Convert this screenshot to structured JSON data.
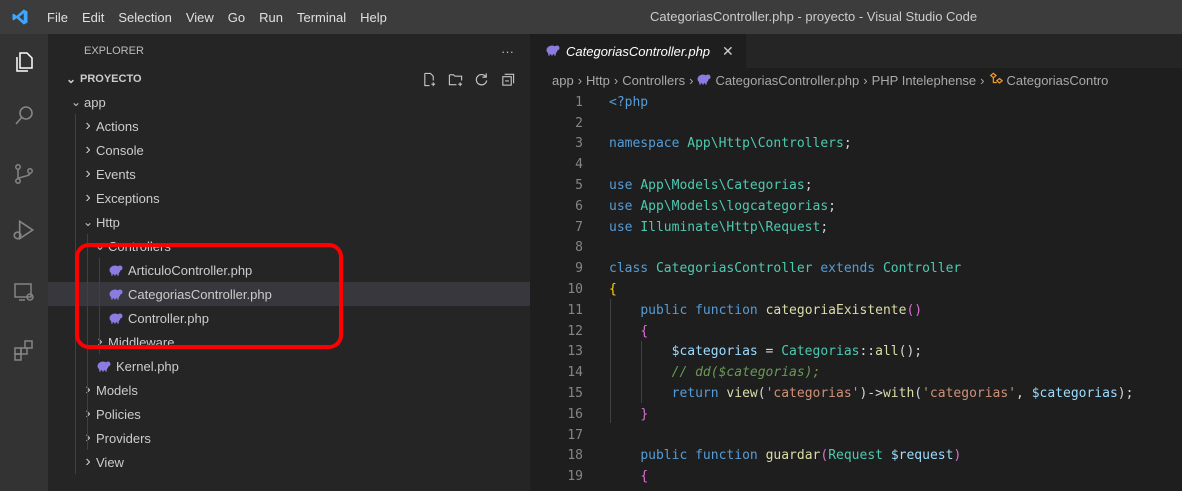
{
  "titlebar": {
    "menu": [
      "File",
      "Edit",
      "Selection",
      "View",
      "Go",
      "Run",
      "Terminal",
      "Help"
    ],
    "window_title": "CategoriasController.php - proyecto - Visual Studio Code"
  },
  "activity_icons": [
    "explorer-icon",
    "search-icon",
    "source-control-icon",
    "run-debug-icon",
    "remote-explorer-icon",
    "extensions-icon"
  ],
  "sidebar": {
    "title": "EXPLORER",
    "more": "···",
    "project": "PROYECTO",
    "project_actions": [
      "new-file-icon",
      "new-folder-icon",
      "refresh-icon",
      "collapse-all-icon"
    ],
    "tree": [
      {
        "label": "app",
        "type": "folder",
        "open": true,
        "depth": 0
      },
      {
        "label": "Actions",
        "type": "folder",
        "open": false,
        "depth": 1
      },
      {
        "label": "Console",
        "type": "folder",
        "open": false,
        "depth": 1
      },
      {
        "label": "Events",
        "type": "folder",
        "open": false,
        "depth": 1
      },
      {
        "label": "Exceptions",
        "type": "folder",
        "open": false,
        "depth": 1
      },
      {
        "label": "Http",
        "type": "folder",
        "open": true,
        "depth": 1
      },
      {
        "label": "Controllers",
        "type": "folder",
        "open": true,
        "depth": 2
      },
      {
        "label": "ArticuloController.php",
        "type": "php",
        "depth": 3
      },
      {
        "label": "CategoriasController.php",
        "type": "php",
        "depth": 3,
        "selected": true
      },
      {
        "label": "Controller.php",
        "type": "php",
        "depth": 3
      },
      {
        "label": "Middleware",
        "type": "folder",
        "open": false,
        "depth": 2
      },
      {
        "label": "Kernel.php",
        "type": "php",
        "depth": 2
      },
      {
        "label": "Models",
        "type": "folder",
        "open": false,
        "depth": 1
      },
      {
        "label": "Policies",
        "type": "folder",
        "open": false,
        "depth": 1
      },
      {
        "label": "Providers",
        "type": "folder",
        "open": false,
        "depth": 1
      },
      {
        "label": "View",
        "type": "folder",
        "open": false,
        "depth": 1
      }
    ]
  },
  "editor": {
    "tab": {
      "label": "CategoriasController.php",
      "close": "✕"
    },
    "breadcrumbs": [
      "app",
      "Http",
      "Controllers",
      "CategoriasController.php",
      "PHP Intelephense",
      "CategoriasContro"
    ],
    "lines": [
      {
        "n": "1",
        "tokens": [
          [
            "tag",
            "<?php"
          ]
        ]
      },
      {
        "n": "2",
        "tokens": []
      },
      {
        "n": "3",
        "tokens": [
          [
            "kw",
            "namespace"
          ],
          [
            "plain",
            " "
          ],
          [
            "cls",
            "App\\Http\\Controllers"
          ],
          [
            "plain",
            ";"
          ]
        ]
      },
      {
        "n": "4",
        "tokens": []
      },
      {
        "n": "5",
        "tokens": [
          [
            "kw",
            "use"
          ],
          [
            "plain",
            " "
          ],
          [
            "cls",
            "App\\Models\\Categorias"
          ],
          [
            "plain",
            ";"
          ]
        ]
      },
      {
        "n": "6",
        "tokens": [
          [
            "kw",
            "use"
          ],
          [
            "plain",
            " "
          ],
          [
            "cls",
            "App\\Models\\logcategorias"
          ],
          [
            "plain",
            ";"
          ]
        ]
      },
      {
        "n": "7",
        "tokens": [
          [
            "kw",
            "use"
          ],
          [
            "plain",
            " "
          ],
          [
            "cls",
            "Illuminate\\Http\\Request"
          ],
          [
            "plain",
            ";"
          ]
        ]
      },
      {
        "n": "8",
        "tokens": []
      },
      {
        "n": "9",
        "tokens": [
          [
            "kw",
            "class"
          ],
          [
            "plain",
            " "
          ],
          [
            "cls",
            "CategoriasController"
          ],
          [
            "plain",
            " "
          ],
          [
            "kw",
            "extends"
          ],
          [
            "plain",
            " "
          ],
          [
            "cls",
            "Controller"
          ]
        ]
      },
      {
        "n": "10",
        "tokens": [
          [
            "br",
            "{"
          ]
        ]
      },
      {
        "n": "11",
        "tokens": [
          [
            "plain",
            "    "
          ],
          [
            "kw",
            "public"
          ],
          [
            "plain",
            " "
          ],
          [
            "kw",
            "function"
          ],
          [
            "plain",
            " "
          ],
          [
            "fn",
            "categoriaExistente"
          ],
          [
            "br2",
            "()"
          ]
        ]
      },
      {
        "n": "12",
        "tokens": [
          [
            "plain",
            "    "
          ],
          [
            "br2",
            "{"
          ]
        ]
      },
      {
        "n": "13",
        "tokens": [
          [
            "plain",
            "        "
          ],
          [
            "var",
            "$categorias"
          ],
          [
            "plain",
            " = "
          ],
          [
            "cls",
            "Categorias"
          ],
          [
            "plain",
            "::"
          ],
          [
            "fn",
            "all"
          ],
          [
            "plain",
            "();"
          ]
        ]
      },
      {
        "n": "14",
        "tokens": [
          [
            "plain",
            "        "
          ],
          [
            "cmt",
            "// dd($categorias);"
          ]
        ]
      },
      {
        "n": "15",
        "tokens": [
          [
            "plain",
            "        "
          ],
          [
            "kw",
            "return"
          ],
          [
            "plain",
            " "
          ],
          [
            "fn",
            "view"
          ],
          [
            "plain",
            "("
          ],
          [
            "str",
            "'categorias'"
          ],
          [
            "plain",
            ")->"
          ],
          [
            "fn",
            "with"
          ],
          [
            "plain",
            "("
          ],
          [
            "str",
            "'categorias'"
          ],
          [
            "plain",
            ", "
          ],
          [
            "var",
            "$categorias"
          ],
          [
            "plain",
            ");"
          ]
        ]
      },
      {
        "n": "16",
        "tokens": [
          [
            "plain",
            "    "
          ],
          [
            "br2",
            "}"
          ]
        ]
      },
      {
        "n": "17",
        "tokens": []
      },
      {
        "n": "18",
        "tokens": [
          [
            "plain",
            "    "
          ],
          [
            "kw",
            "public"
          ],
          [
            "plain",
            " "
          ],
          [
            "kw",
            "function"
          ],
          [
            "plain",
            " "
          ],
          [
            "fn",
            "guardar"
          ],
          [
            "br2",
            "("
          ],
          [
            "cls",
            "Request"
          ],
          [
            "plain",
            " "
          ],
          [
            "var",
            "$request"
          ],
          [
            "br2",
            ")"
          ]
        ]
      },
      {
        "n": "19",
        "tokens": [
          [
            "plain",
            "    "
          ],
          [
            "br2",
            "{"
          ]
        ]
      }
    ]
  },
  "colors": {
    "accent_highlight": "#ff0000",
    "php_icon": "#8a7ce0",
    "vscode_blue": "#3ea6ff"
  }
}
